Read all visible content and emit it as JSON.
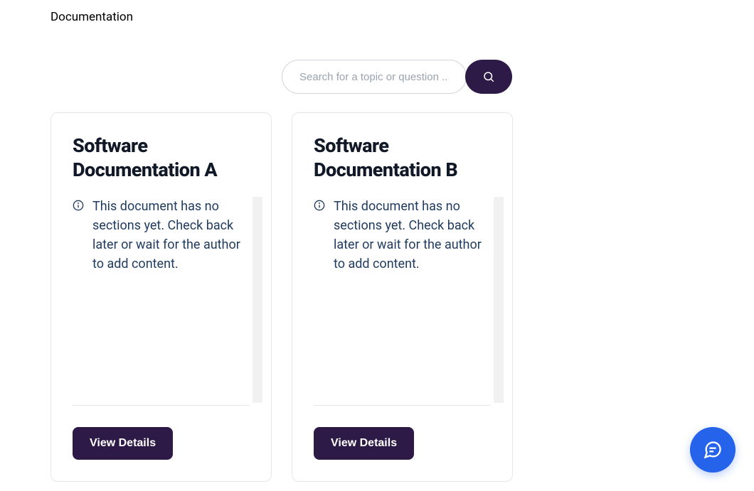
{
  "page": {
    "title": "Documentation"
  },
  "search": {
    "placeholder": "Search for a topic or question ..."
  },
  "cards": [
    {
      "title": "Software Documentation A",
      "message": "This document has no sections yet. Check back later or wait for the author to add content.",
      "button_label": "View Details"
    },
    {
      "title": "Software Documentation B",
      "message": "This document has no sections yet. Check back later or wait for the author to add content.",
      "button_label": "View Details"
    }
  ]
}
